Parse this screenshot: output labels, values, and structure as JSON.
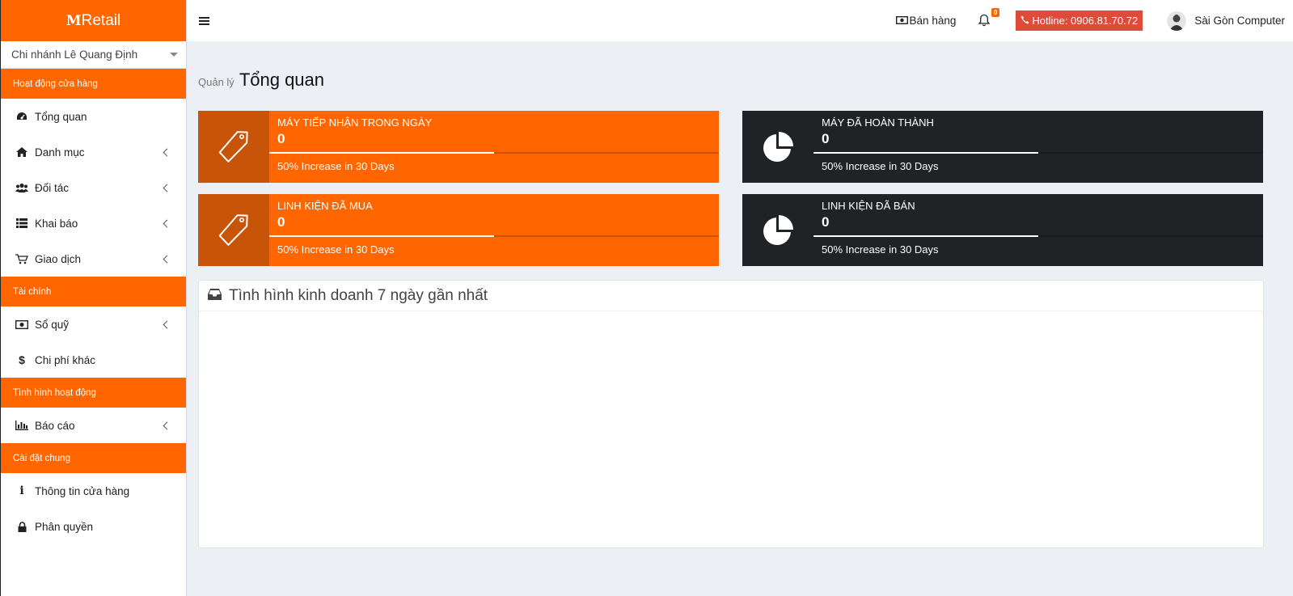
{
  "app": {
    "logo_mark": "M",
    "logo_text": "Retail"
  },
  "sidebar": {
    "branch": "Chi nhánh Lê Quang Định",
    "sections": [
      {
        "header": "Hoạt động cửa hàng"
      },
      {
        "header": "Tài chính"
      },
      {
        "header": "Tình hình hoạt động"
      },
      {
        "header": "Cài đặt chung"
      }
    ],
    "items": [
      {
        "label": "Tổng quan",
        "icon": "dashboard-icon"
      },
      {
        "label": "Danh mục",
        "icon": "home-icon"
      },
      {
        "label": "Đối tác",
        "icon": "users-icon"
      },
      {
        "label": "Khai báo",
        "icon": "list-icon"
      },
      {
        "label": "Giao dịch",
        "icon": "cart-icon"
      },
      {
        "label": "Sổ quỹ",
        "icon": "money-icon"
      },
      {
        "label": "Chi phí khác",
        "icon": "dollar-icon"
      },
      {
        "label": "Báo cáo",
        "icon": "bar-chart-icon"
      },
      {
        "label": "Thông tin cửa hàng",
        "icon": "info-icon"
      },
      {
        "label": "Phân quyền",
        "icon": "lock-icon"
      }
    ]
  },
  "topbar": {
    "sales_label": "Bán hàng",
    "notification_count": "0",
    "hotline": "Hotline: 0906.81.70.72",
    "user_name": "Sài Gòn Computer"
  },
  "page": {
    "breadcrumb": "Quản lý",
    "title": "Tổng quan"
  },
  "stats": [
    {
      "title": "MÁY TIẾP NHẬN TRONG NGÀY",
      "value": "0",
      "desc": "50% Increase in 30 Days",
      "progress": 0.5,
      "color": "#ff6600",
      "icon": "tag-icon"
    },
    {
      "title": "MÁY ĐÃ HOÀN THÀNH",
      "value": "0",
      "desc": "50% Increase in 30 Days",
      "progress": 0.5,
      "color": "#1f2326",
      "icon": "pie-chart-icon"
    },
    {
      "title": "LINH KIỆN ĐÃ MUA",
      "value": "0",
      "desc": "50% Increase in 30 Days",
      "progress": 0.5,
      "color": "#ff6600",
      "icon": "tag-icon"
    },
    {
      "title": "LINH KIỆN ĐÃ BÁN",
      "value": "0",
      "desc": "50% Increase in 30 Days",
      "progress": 0.5,
      "color": "#1f2326",
      "icon": "pie-chart-icon"
    }
  ],
  "panel": {
    "title": "Tình hình kinh doanh 7 ngày gần nhất",
    "icon": "inbox-icon"
  }
}
